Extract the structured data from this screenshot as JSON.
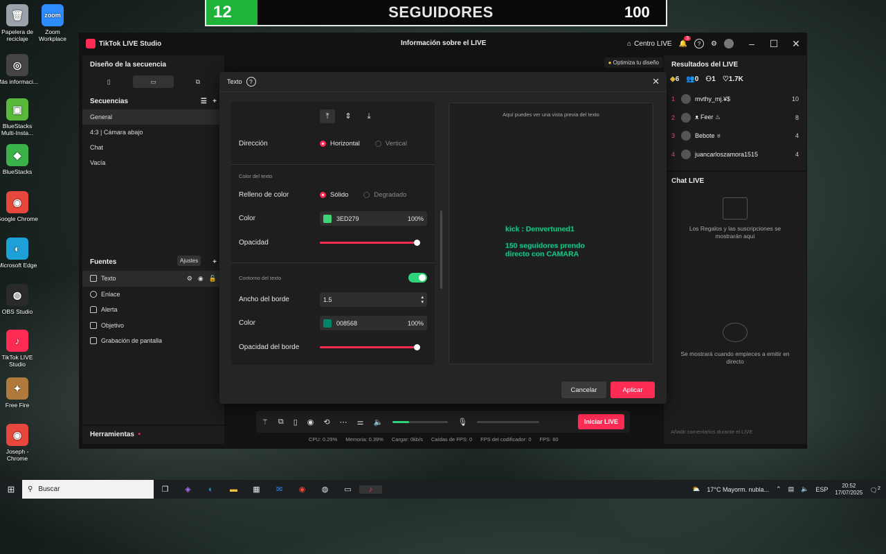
{
  "banner": {
    "count": "12",
    "label": "SEGUIDORES",
    "goal": "100"
  },
  "desktop_icons": [
    {
      "label": "Papelera de reciclaje",
      "color": "#9aa3aa",
      "glyph": "🗑"
    },
    {
      "label": "Zoom Workplace",
      "color": "#2d8cff",
      "glyph": "zoom"
    },
    {
      "label": "Más informaci...",
      "color": "#444444",
      "glyph": "◎"
    },
    {
      "label": "BlueStacks Multi-Insta...",
      "color": "#59b93b",
      "glyph": "▣"
    },
    {
      "label": "BlueStacks",
      "color": "#3bb34a",
      "glyph": "◆"
    },
    {
      "label": "Google Chrome",
      "color": "#e8473b",
      "glyph": "◉"
    },
    {
      "label": "Microsoft Edge",
      "color": "#1ca0d6",
      "glyph": "◐"
    },
    {
      "label": "OBS Studio",
      "color": "#2a2a2a",
      "glyph": "◍"
    },
    {
      "label": "TikTok LIVE Studio",
      "color": "#fe2c55",
      "glyph": "♪"
    },
    {
      "label": "Free Fire",
      "color": "#b07a3c",
      "glyph": "✦"
    },
    {
      "label": "Joseph - Chrome",
      "color": "#e8473b",
      "glyph": "◉"
    }
  ],
  "app": {
    "name": "TikTok LIVE Studio",
    "center_title": "Información sobre el LIVE",
    "live_center": "Centro LIVE",
    "notif_count": "3",
    "optimize_hint": "Optimiza tu diseño"
  },
  "left": {
    "scene_title": "Diseño de la secuencia",
    "sequences_title": "Secuencias",
    "sequences": [
      "General",
      "4:3 | Cámara abajo",
      "Chat",
      "Vacía"
    ],
    "sources_title": "Fuentes",
    "tooltip": "Ajustes",
    "sources": [
      "Texto",
      "Enlace",
      "Alerta",
      "Objetivo",
      "Grabación de pantalla"
    ],
    "tools_title": "Herramientas"
  },
  "right": {
    "results_title": "Resultados del LIVE",
    "stats": [
      "6",
      "0",
      "1",
      "1.7K"
    ],
    "ranking": [
      {
        "rank": "1",
        "name": "mvthy_mj.¥$",
        "points": "10"
      },
      {
        "rank": "2",
        "name": "ᴥ Feer ♨",
        "points": "8"
      },
      {
        "rank": "3",
        "name": "Bebote ♅",
        "points": "4"
      },
      {
        "rank": "4",
        "name": "juancarloszamora1515",
        "points": "4"
      }
    ],
    "chat_title": "Chat LIVE",
    "gifts_note": "Los Regalos y las suscripciones se mostrarán aquí",
    "start_note": "Se mostrará cuando empieces a emitir en directo",
    "comment_placeholder": "Añadir comentarios durante el LIVE"
  },
  "modal": {
    "title": "Texto",
    "direction_label": "Dirección",
    "direction_options": [
      "Horizontal",
      "Vertical"
    ],
    "text_color_section": "Color del texto",
    "fill_label": "Relleno de color",
    "fill_options": [
      "Sólido",
      "Degradado"
    ],
    "color_label": "Color",
    "text_color": {
      "hex": "3ED279",
      "swatch": "#3ed279",
      "opacity": "100%"
    },
    "opacity_label": "Opacidad",
    "outline_section": "Contorno del texto",
    "border_width_label": "Ancho del borde",
    "border_width": "1.5",
    "outline_color": {
      "hex": "008568",
      "swatch": "#008568",
      "opacity": "100%"
    },
    "border_opacity_label": "Opacidad del borde",
    "preview_hint": "Aquí puedes ver una vista previa del texto",
    "preview_line1": "kick : Denvertuned1",
    "preview_line2a": "150 seguidores prendo",
    "preview_line2b": "directo con CAMARA",
    "cancel": "Cancelar",
    "apply": "Aplicar"
  },
  "toolbar": {
    "go_live": "Iniciar LIVE",
    "volume_level": 0.3
  },
  "statusbar": [
    "CPU: 0.29%",
    "Memoria: 0.39%",
    "Cargar: 0kb/s",
    "Caídas de FPS: 0",
    "FPS del codificador: 0",
    "FPS: 60"
  ],
  "taskbar": {
    "search": "Buscar",
    "weather": "17°C  Mayorm. nubla...",
    "lang": "ESP",
    "time": "20:52",
    "date": "17/07/2025",
    "notif": "2"
  }
}
